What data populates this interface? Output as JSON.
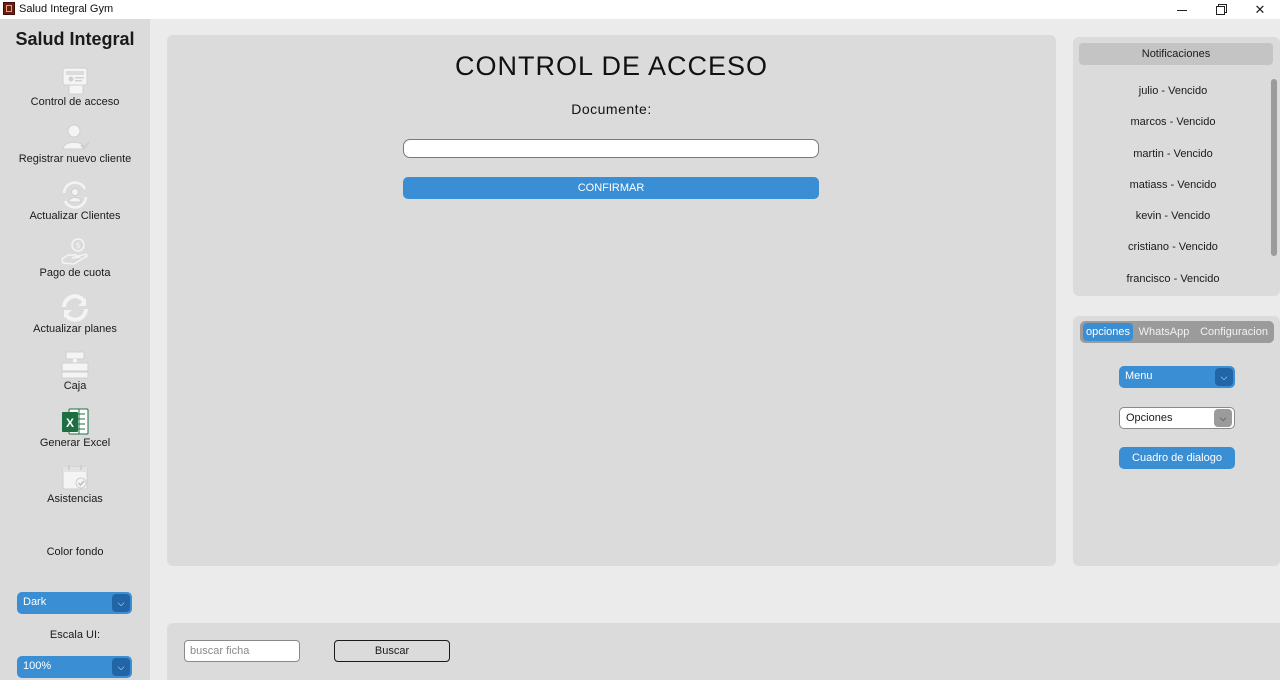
{
  "window": {
    "title": "Salud Integral Gym",
    "minimize_label": "",
    "maximize_label": "",
    "close_label": "✕"
  },
  "sidebar": {
    "brand": "Salud Integral",
    "items": [
      {
        "label": "Control de acceso",
        "icon": "access-control-icon"
      },
      {
        "label": "Registrar nuevo cliente",
        "icon": "add-user-icon"
      },
      {
        "label": "Actualizar Clientes",
        "icon": "user-refresh-icon"
      },
      {
        "label": "Pago de cuota",
        "icon": "payment-icon"
      },
      {
        "label": "Actualizar planes",
        "icon": "refresh-icon"
      },
      {
        "label": "Caja",
        "icon": "cash-register-icon"
      },
      {
        "label": "Generar Excel",
        "icon": "excel-icon"
      },
      {
        "label": "Asistencias",
        "icon": "calendar-check-icon"
      }
    ],
    "color_label": "Color fondo",
    "color_value": "Dark",
    "scale_label": "Escala UI:",
    "scale_value": "100%"
  },
  "main": {
    "title": "CONTROL DE ACCESO",
    "document_label": "Documente:",
    "document_value": "",
    "confirm_label": "CONFIRMAR"
  },
  "notifications": {
    "header": "Notificaciones",
    "items": [
      "julio - Vencido",
      "marcos - Vencido",
      "martin - Vencido",
      "matiass - Vencido",
      "kevin - Vencido",
      "cristiano - Vencido",
      "francisco  - Vencido"
    ]
  },
  "options": {
    "tabs": [
      {
        "label": "opciones",
        "active": true
      },
      {
        "label": "WhatsApp",
        "active": false
      },
      {
        "label": "Configuracion",
        "active": false
      }
    ],
    "menu_value": "Menu",
    "options_value": "Opciones",
    "dialog_label": "Cuadro de dialogo"
  },
  "bottom": {
    "search_placeholder": "buscar ficha",
    "search_value": "",
    "search_button": "Buscar"
  },
  "colors": {
    "accent": "#3a8ed4",
    "accent_dark": "#2265a6",
    "panel": "#dbdbdb",
    "background": "#ebebeb",
    "excel_green": "#1d6f42"
  }
}
